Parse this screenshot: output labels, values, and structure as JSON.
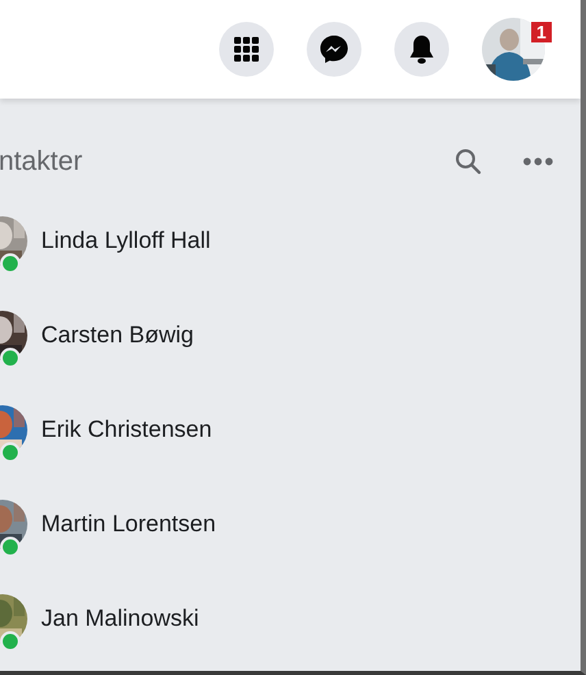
{
  "top_bar": {
    "badge": "1"
  },
  "contacts": {
    "title": "ntakter",
    "items": [
      {
        "name": "Linda Lylloff Hall",
        "online": true
      },
      {
        "name": "Carsten Bøwig",
        "online": true
      },
      {
        "name": "Erik Christensen",
        "online": true
      },
      {
        "name": "Martin Lorentsen",
        "online": true
      },
      {
        "name": "Jan Malinowski",
        "online": true
      }
    ]
  }
}
